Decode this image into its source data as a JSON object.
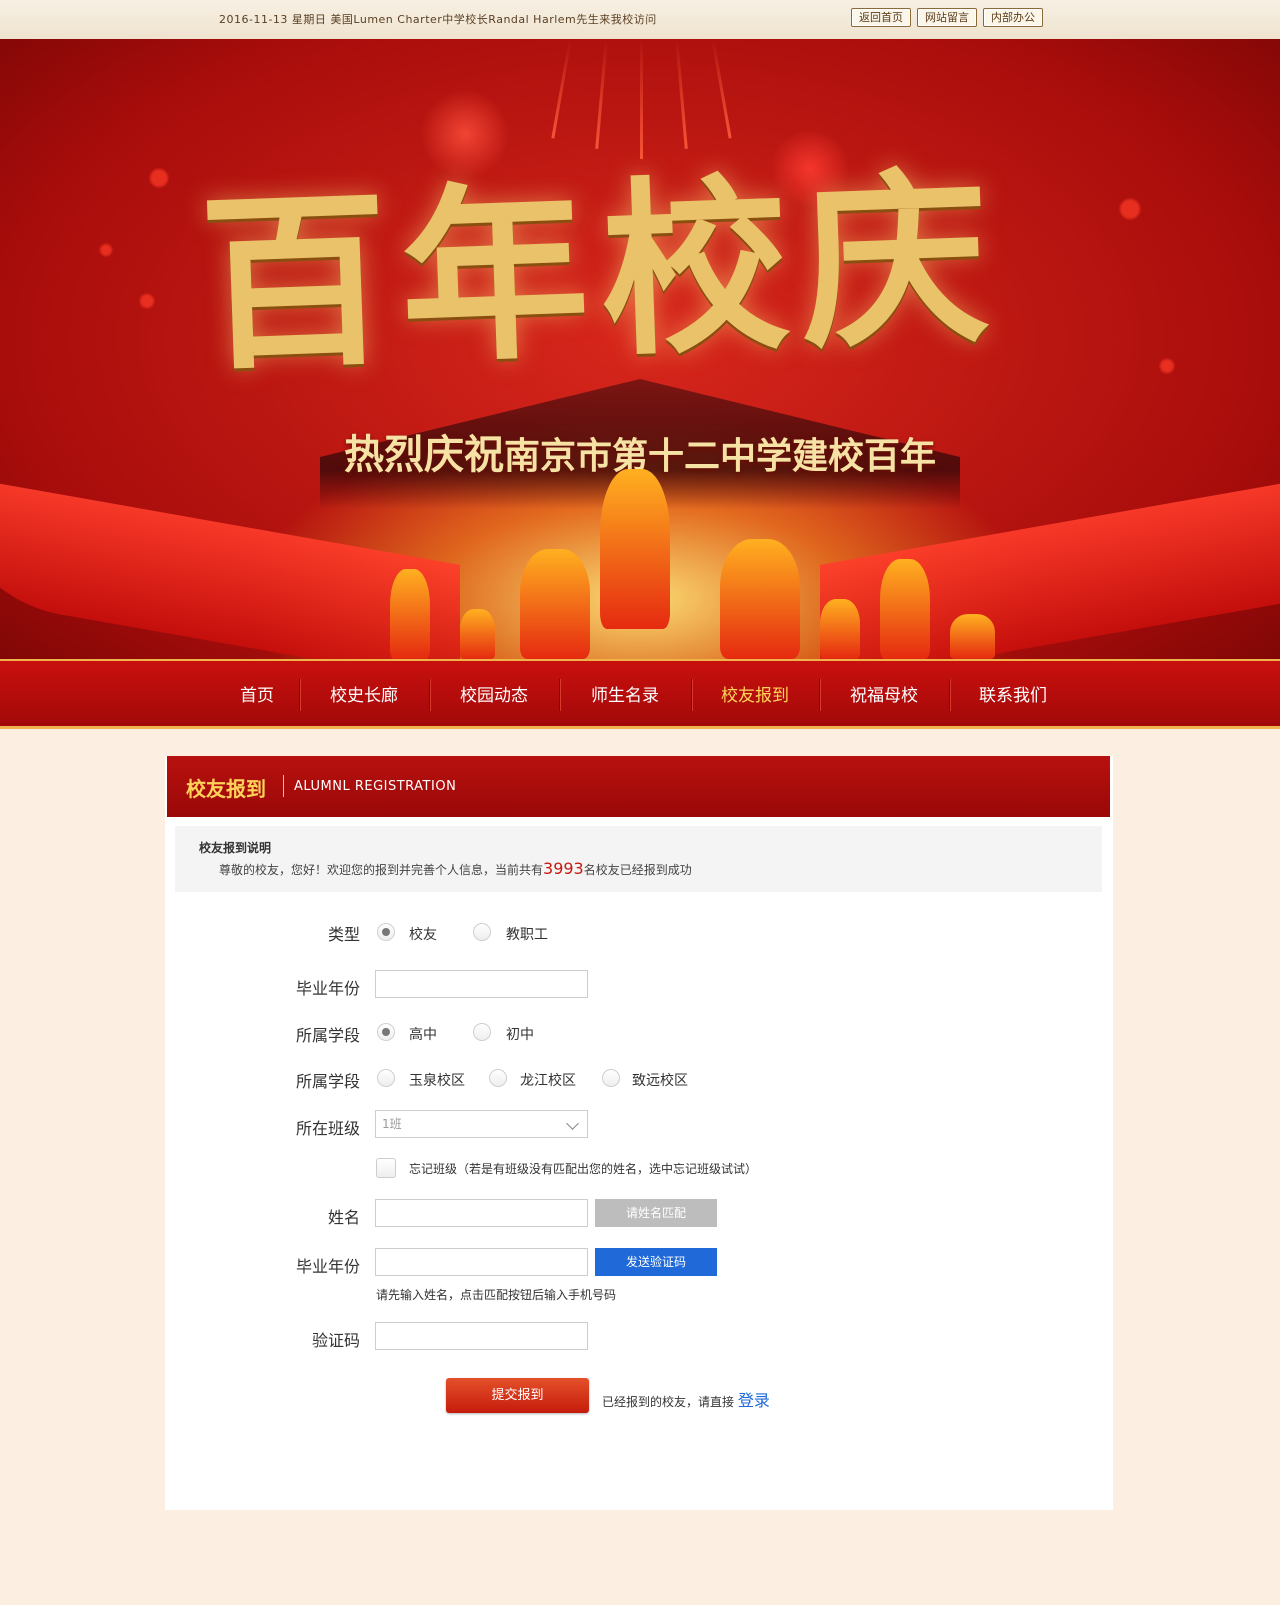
{
  "topbar": {
    "news": "2016-11-13  星期日  美国Lumen Charter中学校长Randal Harlem先生来我校访问",
    "links": [
      "返回首页",
      "网站留言",
      "内部办公"
    ]
  },
  "banner": {
    "title": "百年校庆",
    "subtitle_big": "热烈庆祝",
    "subtitle_rest": "南京市第十二中学建校百年"
  },
  "nav": {
    "items": [
      "首页",
      "校史长廊",
      "校园动态",
      "师生名录",
      "校友报到",
      "祝福母校",
      "联系我们"
    ],
    "active": "校友报到"
  },
  "panel": {
    "title_cn": "校友报到",
    "title_en": "ALUMNL  REGISTRATION"
  },
  "notice": {
    "title": "校友报到说明",
    "text_before": "尊敬的校友，您好！欢迎您的报到并完善个人信息，当前共有",
    "count": "3993",
    "text_after": "名校友已经报到成功"
  },
  "form": {
    "type_label": "类型",
    "type_options": [
      "校友",
      "教职工"
    ],
    "type_selected": "校友",
    "grad_year_label": "毕业年份",
    "grad_year_value": "",
    "stage_label": "所属学段",
    "stage_options": [
      "高中",
      "初中"
    ],
    "stage_selected": "高中",
    "campus_label": "所属学段",
    "campus_options": [
      "玉泉校区",
      "龙江校区",
      "致远校区"
    ],
    "class_label": "所在班级",
    "class_value": "1班",
    "forget_class_text": "忘记班级（若是有班级没有匹配出您的姓名，选中忘记班级试试）",
    "name_label": "姓名",
    "name_value": "",
    "match_button": "请姓名匹配",
    "phone_label": "毕业年份",
    "phone_value": "",
    "send_code_button": "发送验证码",
    "phone_hint": "请先输入姓名，点击匹配按钮后输入手机号码",
    "code_label": "验证码",
    "code_value": "",
    "submit_button": "提交报到",
    "login_tip": "已经报到的校友，请直接 ",
    "login_link": "登录"
  },
  "colors": {
    "brand_red": "#a90d0b",
    "gold": "#ffd25a",
    "link_blue": "#1f69d8"
  }
}
